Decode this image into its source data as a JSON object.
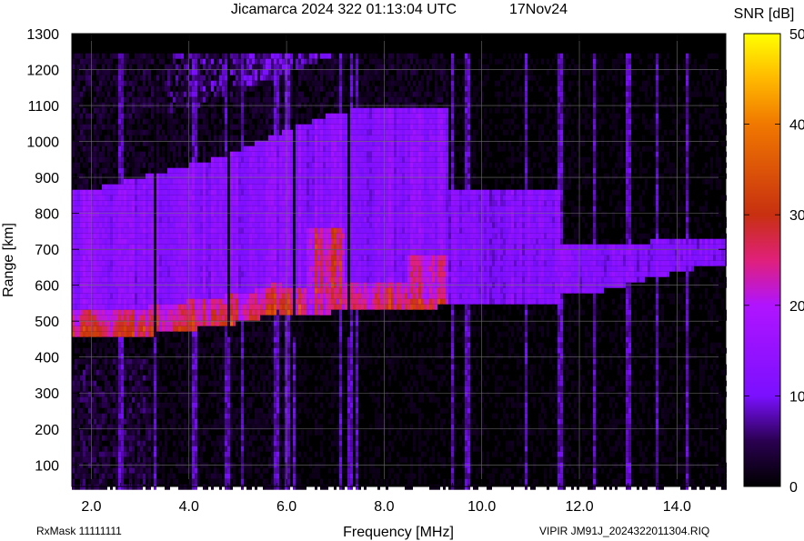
{
  "header": {
    "title": "Jicamarca 2024 322 01:13:04 UTC",
    "date": "17Nov24"
  },
  "footer": {
    "rxmask": "RxMask 11111111",
    "file": "VIPIR  JM91J_2024322011304.RIQ"
  },
  "chart_data": {
    "type": "heatmap",
    "title": "Jicamarca 2024 322 01:13:04 UTC",
    "xlabel": "Frequency [MHz]",
    "ylabel": "Range [km]",
    "xlim": [
      1.6,
      15.0
    ],
    "ylim": [
      40,
      1300
    ],
    "x_ticks": [
      2.0,
      4.0,
      6.0,
      8.0,
      10.0,
      12.0,
      14.0
    ],
    "x_tick_labels": [
      "2.0",
      "4.0",
      "6.0",
      "8.0",
      "10.0",
      "12.0",
      "14.0"
    ],
    "y_ticks": [
      100,
      200,
      300,
      400,
      500,
      600,
      700,
      800,
      900,
      1000,
      1100,
      1200,
      1300
    ],
    "y_tick_labels": [
      "100",
      "200",
      "300",
      "400",
      "500",
      "600",
      "700",
      "800",
      "900",
      "1000",
      "1100",
      "1200",
      "1300"
    ],
    "data_range_max": 1245,
    "grid": true,
    "colorbar": {
      "label": "SNR [dB]",
      "range": [
        0,
        50
      ],
      "ticks": [
        0,
        10,
        20,
        30,
        40,
        50
      ],
      "tick_labels": [
        "0",
        "10",
        "20",
        "30",
        "40",
        "50"
      ]
    },
    "traces": {
      "o_trace_1": [
        [
          1.8,
          470
        ],
        [
          2.5,
          470
        ],
        [
          3.0,
          475
        ],
        [
          3.5,
          487
        ],
        [
          4.0,
          495
        ],
        [
          4.5,
          505
        ],
        [
          5.0,
          515
        ],
        [
          5.5,
          530
        ],
        [
          5.8,
          545
        ],
        [
          6.0,
          535
        ],
        [
          6.5,
          540
        ],
        [
          7.0,
          545
        ],
        [
          7.5,
          550
        ],
        [
          8.5,
          555
        ],
        [
          9.2,
          560
        ]
      ],
      "o_trace_upper": [
        [
          9.5,
          560
        ],
        [
          10.5,
          555
        ],
        [
          11.5,
          570
        ],
        [
          12.5,
          585
        ],
        [
          13.5,
          620
        ],
        [
          14.5,
          650
        ]
      ],
      "spread_top": [
        [
          1.8,
          860
        ],
        [
          3.0,
          900
        ],
        [
          4.5,
          950
        ],
        [
          6.0,
          1030
        ],
        [
          7.0,
          1080
        ],
        [
          8.0,
          1100
        ]
      ]
    },
    "interference_frequencies": [
      2.6,
      3.3,
      4.1,
      4.8,
      5.1,
      5.8,
      6.0,
      6.15,
      7.1,
      7.3,
      7.45,
      9.4,
      9.7,
      10.9,
      11.6,
      12.3,
      13.0,
      13.6,
      14.2
    ]
  }
}
